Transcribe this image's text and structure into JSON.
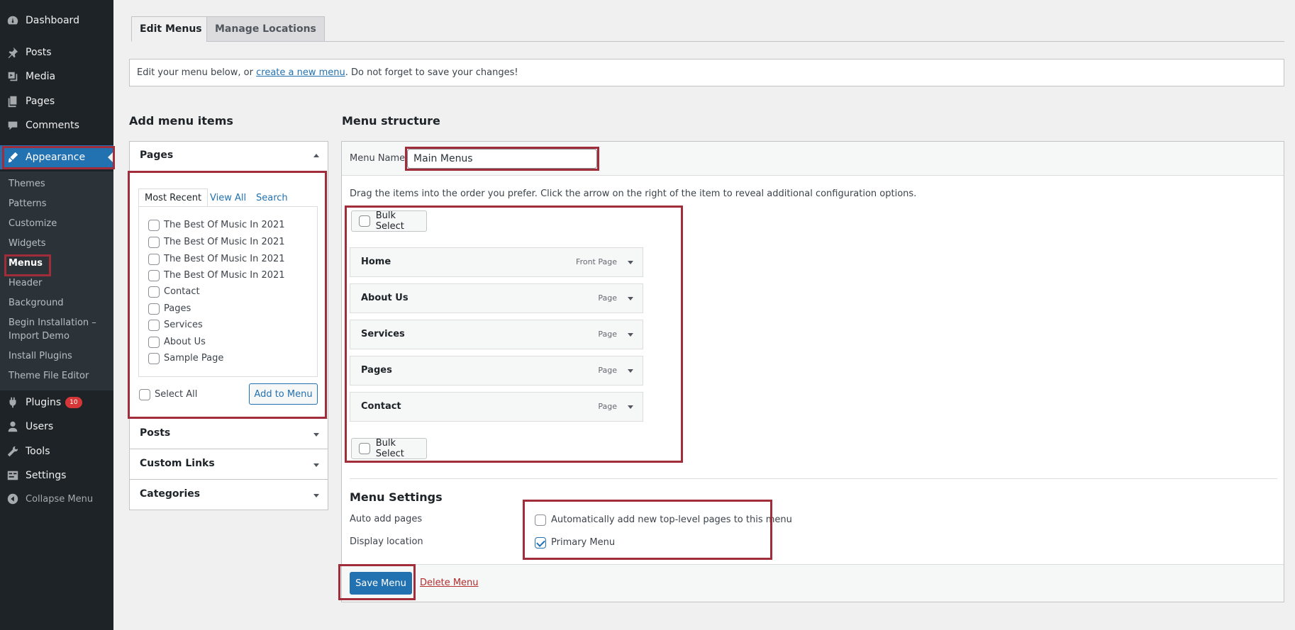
{
  "sidebar": {
    "items": [
      {
        "label": "Dashboard",
        "icon": "dashboard-icon"
      },
      {
        "label": "Posts",
        "icon": "pin-icon"
      },
      {
        "label": "Media",
        "icon": "media-icon"
      },
      {
        "label": "Pages",
        "icon": "pages-icon"
      },
      {
        "label": "Comments",
        "icon": "comment-icon"
      },
      {
        "label": "Appearance",
        "icon": "brush-icon"
      },
      {
        "label": "Plugins",
        "icon": "plugin-icon",
        "badge": "10"
      },
      {
        "label": "Users",
        "icon": "user-icon"
      },
      {
        "label": "Tools",
        "icon": "wrench-icon"
      },
      {
        "label": "Settings",
        "icon": "settings-icon"
      },
      {
        "label": "Collapse Menu",
        "icon": "collapse-icon"
      }
    ],
    "submenu": [
      "Themes",
      "Patterns",
      "Customize",
      "Widgets",
      "Menus",
      "Header",
      "Background",
      "Begin Installation –",
      "Import Demo",
      "Install Plugins",
      "Theme File Editor"
    ]
  },
  "tabs": [
    "Edit Menus",
    "Manage Locations"
  ],
  "notice": {
    "before": "Edit your menu below, or ",
    "link": "create a new menu",
    "after": ". Do not forget to save your changes!"
  },
  "add_items": {
    "title": "Add menu items",
    "pages_section": "Pages",
    "inner_tabs": [
      "Most Recent",
      "View All",
      "Search"
    ],
    "pages": [
      "The Best Of Music In 2021",
      "The Best Of Music In 2021",
      "The Best Of Music In 2021",
      "The Best Of Music In 2021",
      "Contact",
      "Pages",
      "Services",
      "About Us",
      "Sample Page"
    ],
    "select_all": "Select All",
    "add_button": "Add to Menu",
    "other_sections": [
      "Posts",
      "Custom Links",
      "Categories"
    ]
  },
  "structure": {
    "title": "Menu structure",
    "name_label": "Menu Name",
    "name_value": "Main Menus",
    "instructions": "Drag the items into the order you prefer. Click the arrow on the right of the item to reveal additional configuration options.",
    "bulk_select": "Bulk Select",
    "items": [
      {
        "title": "Home",
        "type": "Front Page"
      },
      {
        "title": "About Us",
        "type": "Page"
      },
      {
        "title": "Services",
        "type": "Page"
      },
      {
        "title": "Pages",
        "type": "Page"
      },
      {
        "title": "Contact",
        "type": "Page"
      }
    ],
    "settings_title": "Menu Settings",
    "auto_add_label": "Auto add pages",
    "auto_add_option": "Automatically add new top-level pages to this menu",
    "display_label": "Display location",
    "display_option": "Primary Menu",
    "save_button": "Save Menu",
    "delete_link": "Delete Menu"
  },
  "colors": {
    "accent": "#2271b1",
    "highlight": "#a12c3a",
    "sidebar": "#1d2327"
  }
}
